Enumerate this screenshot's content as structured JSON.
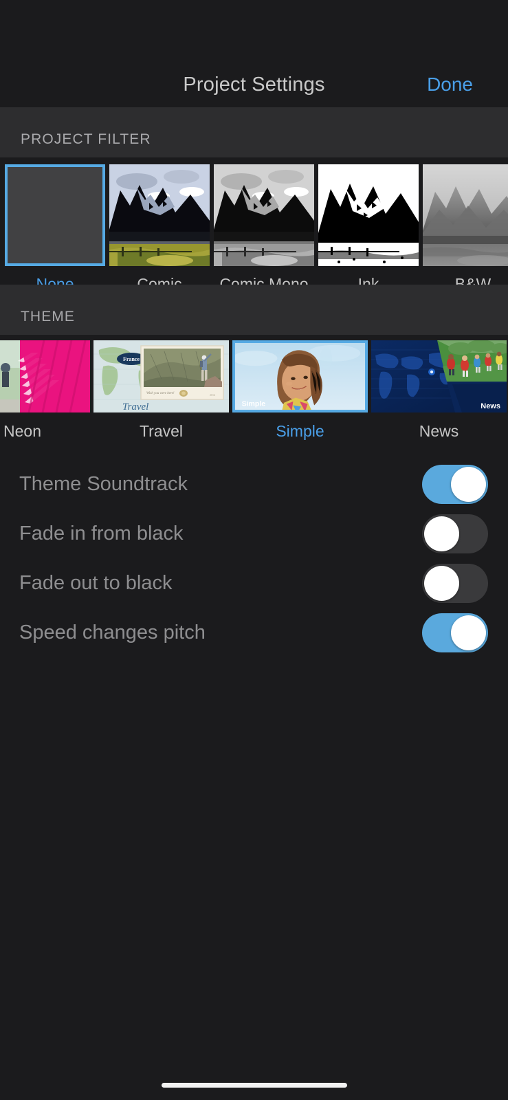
{
  "navbar": {
    "title": "Project Settings",
    "done_label": "Done",
    "accent_color": "#4a9fe8"
  },
  "project_filter": {
    "header": "PROJECT FILTER",
    "selected": "None",
    "items": [
      {
        "label": "None",
        "thumb": "empty-gray-swatch",
        "selected": true
      },
      {
        "label": "Comic",
        "thumb": "comic-mountain-color",
        "selected": false
      },
      {
        "label": "Comic Mono",
        "thumb": "comic-mountain-gray",
        "selected": false
      },
      {
        "label": "Ink",
        "thumb": "ink-mountain-highcontrast",
        "selected": false
      },
      {
        "label": "B&W",
        "thumb": "bw-mountain-photo",
        "selected": false
      }
    ]
  },
  "theme": {
    "header": "THEME",
    "selected": "Simple",
    "items": [
      {
        "label": "Neon",
        "thumb": "neon-pink-person",
        "caption": "",
        "selected": false
      },
      {
        "label": "Travel",
        "thumb": "travel-map-postcard",
        "caption": "Travel",
        "selected": false
      },
      {
        "label": "Simple",
        "thumb": "simple-girl-sky",
        "caption": "Simple",
        "selected": true
      },
      {
        "label": "News",
        "thumb": "news-blue-globe",
        "caption": "News",
        "selected": false
      }
    ],
    "travel_map_pin_label": "France",
    "travel_script_label": "Travel"
  },
  "settings_rows": [
    {
      "label": "Theme Soundtrack",
      "value": "on"
    },
    {
      "label": "Fade in from black",
      "value": "off"
    },
    {
      "label": "Fade out to black",
      "value": "off"
    },
    {
      "label": "Speed changes pitch",
      "value": "on"
    }
  ],
  "colors": {
    "background": "#1b1b1d",
    "section_header_bg": "#2d2d2f",
    "accent": "#4a9fe8",
    "switch_on": "#5aa9dd",
    "switch_off": "#3a3a3c"
  },
  "home_indicator": "home-indicator-bar"
}
